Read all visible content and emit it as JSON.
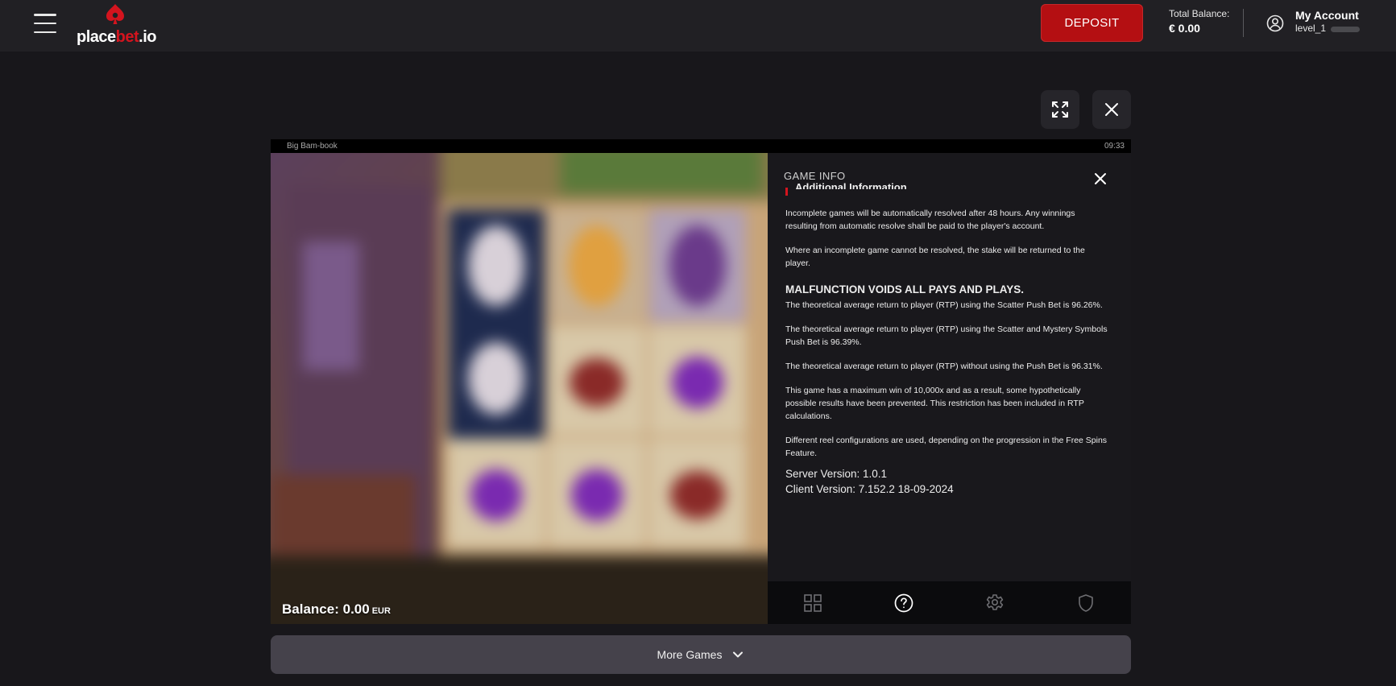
{
  "header": {
    "logo": {
      "text_white": "place",
      "text_red": "bet",
      "text_suffix": ".io"
    },
    "deposit_label": "DEPOSIT",
    "balance_label": "Total Balance:",
    "balance_value": "€ 0.00",
    "account_title": "My Account",
    "account_level": "level_1"
  },
  "game": {
    "name": "Big Bam-book",
    "clock": "09:33",
    "balance_label": "Balance:",
    "balance_value": "0.00",
    "balance_currency": "EUR"
  },
  "info_panel": {
    "title": "GAME INFO",
    "partial_heading": "Additional Information",
    "paragraphs_1": [
      "Incomplete games will be automatically resolved after 48 hours. Any winnings resulting from automatic resolve shall be paid to the player's account.",
      "Where an incomplete game cannot be resolved, the stake will be returned to the player."
    ],
    "malfunction_heading": "MALFUNCTION VOIDS ALL PAYS AND PLAYS.",
    "paragraphs_2": [
      "The theoretical average return to player (RTP) using the Scatter Push Bet is 96.26%.",
      "The theoretical average return to player (RTP) using the Scatter and Mystery Symbols Push Bet is 96.39%.",
      "The theoretical average return to player (RTP) without using the Push Bet is 96.31%.",
      "This game has a maximum win of 10,000x and as a result, some hypothetically possible results have been prevented. This restriction has been included in RTP calculations.",
      "Different reel configurations are used, depending on the progression in the Free Spins Feature."
    ],
    "server_version": "Server Version: 1.0.1",
    "client_version": "Client Version: 7.152.2 18-09-2024",
    "tabs": [
      {
        "icon": "grid-icon",
        "active": false
      },
      {
        "icon": "help-icon",
        "active": true
      },
      {
        "icon": "settings-gear-icon",
        "active": false
      },
      {
        "icon": "shield-icon",
        "active": false
      }
    ]
  },
  "more_games_label": "More Games",
  "colors": {
    "background": "#18171b",
    "header": "#212024",
    "deposit": "#b40f12",
    "brand_red": "#d4141e",
    "more_games_bar": "#45424b"
  }
}
